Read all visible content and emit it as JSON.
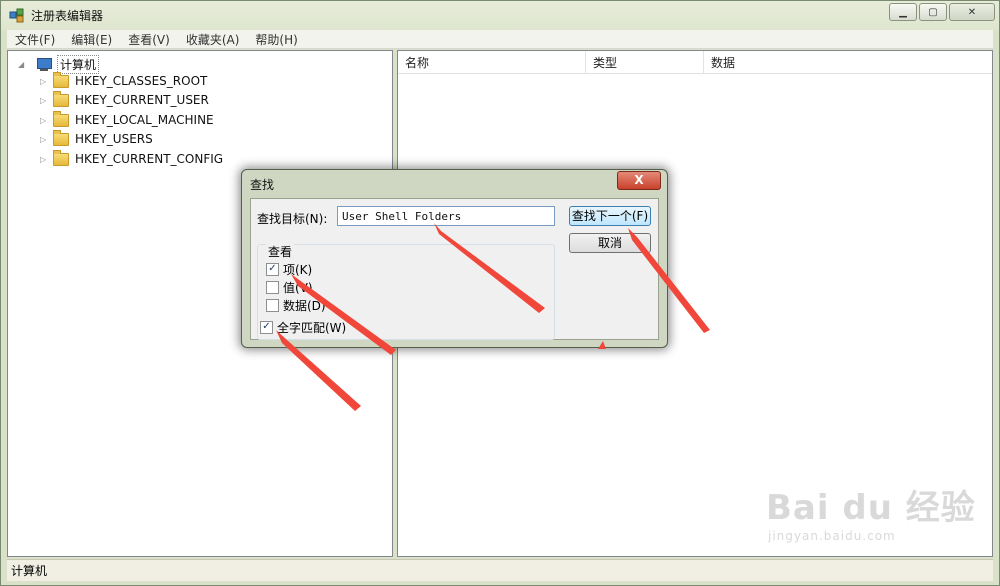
{
  "window": {
    "title": "注册表编辑器",
    "min_label": "▁",
    "max_label": "▢",
    "close_label": "✕"
  },
  "menu": [
    "文件(F)",
    "编辑(E)",
    "查看(V)",
    "收藏夹(A)",
    "帮助(H)"
  ],
  "tree": {
    "root": "计算机",
    "items": [
      "HKEY_CLASSES_ROOT",
      "HKEY_CURRENT_USER",
      "HKEY_LOCAL_MACHINE",
      "HKEY_USERS",
      "HKEY_CURRENT_CONFIG"
    ]
  },
  "list": {
    "columns": [
      "名称",
      "类型",
      "数据"
    ]
  },
  "status": "计算机",
  "find_dialog": {
    "title": "查找",
    "close_label": "X",
    "find_label": "查找目标(N):",
    "find_value": "User Shell Folders",
    "find_next_label": "查找下一个(F)",
    "cancel_label": "取消",
    "group_title": "查看",
    "options": [
      {
        "label": "项(K)",
        "checked": true
      },
      {
        "label": "值(V)",
        "checked": false
      },
      {
        "label": "数据(D)",
        "checked": false
      }
    ],
    "match_whole": {
      "label": "全字匹配(W)",
      "checked": true
    }
  },
  "colors": {
    "annotation_arrow": "#f0473a",
    "primary_button": "#bee6fd",
    "close_button": "#c8412a"
  },
  "watermark": {
    "brand": "Bai du 经验",
    "url": "jingyan.baidu.com"
  }
}
